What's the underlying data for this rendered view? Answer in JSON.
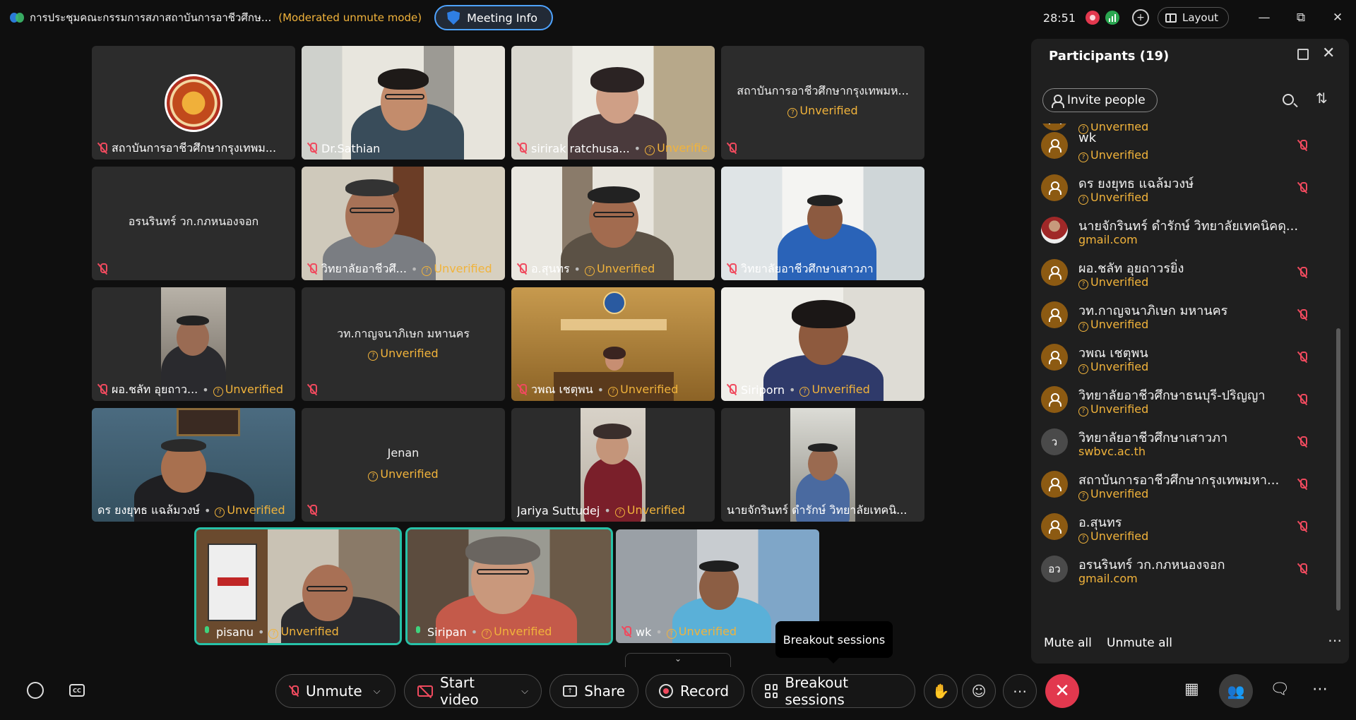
{
  "titlebar": {
    "meeting_title": "การประชุมคณะกรรมการสภาสถาบันการอาชีวศึกษ...",
    "mode": "(Moderated unmute mode)",
    "meeting_info": "Meeting Info",
    "timer": "28:51",
    "layout": "Layout"
  },
  "labels": {
    "unverified": "Unverified"
  },
  "tiles": [
    {
      "name": "สถาบันการอาชีวศึกษากรุงเทพม...",
      "unverified": false
    },
    {
      "name": "Dr.Sathian",
      "unverified": false
    },
    {
      "name": "sirirak ratchusa...",
      "unverified": true
    },
    {
      "name": "สถาบันการอาชีวศึกษากรุงเทพมห...",
      "unverified": true
    },
    {
      "name": "อรนรินทร์ วก.กภหนองจอก",
      "unverified": false
    },
    {
      "name": "วิทยาลัยอาชีวศึ...",
      "unverified": true
    },
    {
      "name": "อ.สุนทร",
      "unverified": true
    },
    {
      "name": "วิทยาลัยอาชีวศึกษาเสาวภา",
      "unverified": false
    },
    {
      "name": "ผอ.ชลัท อุยถาว...",
      "unverified": true
    },
    {
      "name": "วท.กาญจนาภิเษก มหานคร",
      "unverified": true
    },
    {
      "name": "วพณ เชตุพน",
      "unverified": true
    },
    {
      "name": "Siriporn",
      "unverified": true
    },
    {
      "name": "ดร ยงยุทธ แฉล้มวงษ์",
      "unverified": true
    },
    {
      "name": "Jenan",
      "unverified": true
    },
    {
      "name": "Jariya Suttudej",
      "unverified": true
    },
    {
      "name": "นายจักรินทร์ ดำรักษ์ วิทยาลัยเทคนิ...",
      "unverified": false
    },
    {
      "name": "pisanu",
      "unverified": true
    },
    {
      "name": "Siripan",
      "unverified": true
    },
    {
      "name": "wk",
      "unverified": true
    }
  ],
  "panel": {
    "title": "Participants (19)",
    "invite": "Invite people",
    "mute_all": "Mute all",
    "unmute_all": "Unmute all",
    "participants": [
      {
        "name": "",
        "sub": "Unverified",
        "avatar": "person"
      },
      {
        "name": "wk",
        "sub": "Unverified",
        "avatar": "person"
      },
      {
        "name": "ดร ยงยุทธ แฉล้มวงษ์",
        "sub": "Unverified",
        "avatar": "person"
      },
      {
        "name": "นายจักรินทร์ ดำรักษ์ วิทยาลัยเทคนิคดุ...",
        "sub": "gmail.com",
        "avatar": "photo"
      },
      {
        "name": "ผอ.ชลัท อุยถาวรยิ่ง",
        "sub": "Unverified",
        "avatar": "person"
      },
      {
        "name": "วท.กาญจนาภิเษก มหานคร",
        "sub": "Unverified",
        "avatar": "person"
      },
      {
        "name": "วพณ เชตุพน",
        "sub": "Unverified",
        "avatar": "person"
      },
      {
        "name": "วิทยาลัยอาชีวศึกษาธนบุรี-ปริญญา",
        "sub": "Unverified",
        "avatar": "person"
      },
      {
        "name": "วิทยาลัยอาชีวศึกษาเสาวภา",
        "sub": "swbvc.ac.th",
        "avatar": "ว"
      },
      {
        "name": "สถาบันการอาชีวศึกษากรุงเทพมหา...",
        "sub": "Unverified",
        "avatar": "person"
      },
      {
        "name": "อ.สุนทร",
        "sub": "Unverified",
        "avatar": "person"
      },
      {
        "name": "อรนรินทร์ วก.กภหนองจอก",
        "sub": "gmail.com",
        "avatar": "อว"
      }
    ]
  },
  "tooltip": "Breakout sessions",
  "toolbar": {
    "unmute": "Unmute",
    "start_video": "Start video",
    "share": "Share",
    "record": "Record",
    "breakout": "Breakout sessions"
  },
  "colors": {
    "accent": "#4ea3ff",
    "unverified": "#f1b33b",
    "mic_off": "#ef4a5e",
    "end_call": "#e2384e",
    "speaking": "#27c2a8"
  }
}
